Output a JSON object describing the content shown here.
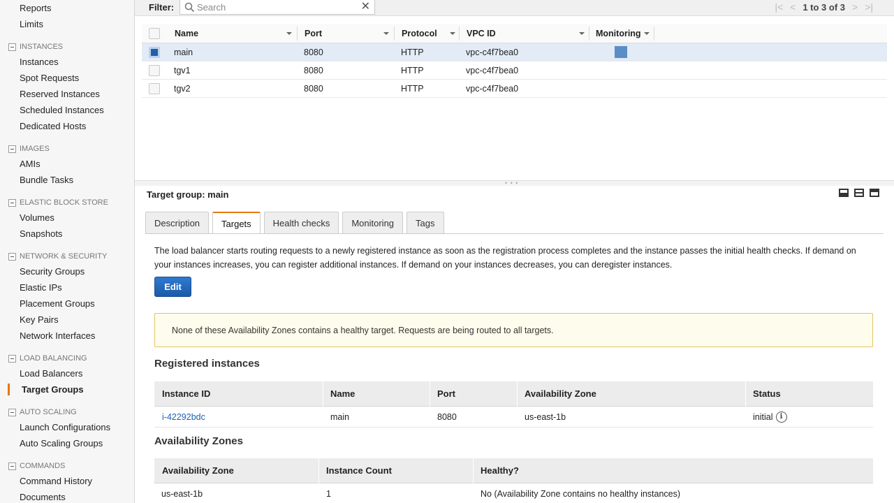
{
  "sidebar": {
    "items_top": [
      "Reports",
      "Limits"
    ],
    "sections": [
      {
        "title": "INSTANCES",
        "items": [
          "Instances",
          "Spot Requests",
          "Reserved Instances",
          "Scheduled Instances",
          "Dedicated Hosts"
        ]
      },
      {
        "title": "IMAGES",
        "items": [
          "AMIs",
          "Bundle Tasks"
        ]
      },
      {
        "title": "ELASTIC BLOCK STORE",
        "items": [
          "Volumes",
          "Snapshots"
        ]
      },
      {
        "title": "NETWORK & SECURITY",
        "items": [
          "Security Groups",
          "Elastic IPs",
          "Placement Groups",
          "Key Pairs",
          "Network Interfaces"
        ]
      },
      {
        "title": "LOAD BALANCING",
        "items": [
          "Load Balancers",
          "Target Groups"
        ]
      },
      {
        "title": "AUTO SCALING",
        "items": [
          "Launch Configurations",
          "Auto Scaling Groups"
        ]
      },
      {
        "title": "COMMANDS",
        "items": [
          "Command History",
          "Documents"
        ]
      }
    ]
  },
  "filter": {
    "label": "Filter:",
    "placeholder": "Search",
    "clear": "✕"
  },
  "pager": {
    "text": "1 to 3 of 3"
  },
  "target_table": {
    "headers": {
      "name": "Name",
      "port": "Port",
      "protocol": "Protocol",
      "vpc": "VPC ID",
      "monitoring": "Monitoring"
    },
    "rows": [
      {
        "name": "main",
        "port": "8080",
        "protocol": "HTTP",
        "vpc": "vpc-c4f7bea0",
        "selected": true
      },
      {
        "name": "tgv1",
        "port": "8080",
        "protocol": "HTTP",
        "vpc": "vpc-c4f7bea0",
        "selected": false
      },
      {
        "name": "tgv2",
        "port": "8080",
        "protocol": "HTTP",
        "vpc": "vpc-c4f7bea0",
        "selected": false
      }
    ]
  },
  "detail": {
    "title": "Target group: main",
    "tabs": [
      "Description",
      "Targets",
      "Health checks",
      "Monitoring",
      "Tags"
    ],
    "active_tab": "Targets",
    "description": "The load balancer starts routing requests to a newly registered instance as soon as the registration process completes and the instance passes the initial health checks. If demand on your instances increases, you can register additional instances. If demand on your instances decreases, you can deregister instances.",
    "edit_label": "Edit",
    "warning": "None of these Availability Zones contains a healthy target. Requests are being routed to all targets.",
    "registered_title": "Registered instances",
    "registered_headers": {
      "instance_id": "Instance ID",
      "name": "Name",
      "port": "Port",
      "az": "Availability Zone",
      "status": "Status"
    },
    "registered_rows": [
      {
        "instance_id": "i-42292bdc",
        "name": "main",
        "port": "8080",
        "az": "us-east-1b",
        "status": "initial"
      }
    ],
    "az_title": "Availability Zones",
    "az_headers": {
      "az": "Availability Zone",
      "count": "Instance Count",
      "healthy": "Healthy?"
    },
    "az_rows": [
      {
        "az": "us-east-1b",
        "count": "1",
        "healthy": "No (Availability Zone contains no healthy instances)"
      }
    ]
  },
  "colors": {
    "accent": "#e47911",
    "link": "#1a62b5",
    "button": "#1f6bc4",
    "selected_row": "#e2ebf6",
    "warning_bg": "#fefcec"
  }
}
